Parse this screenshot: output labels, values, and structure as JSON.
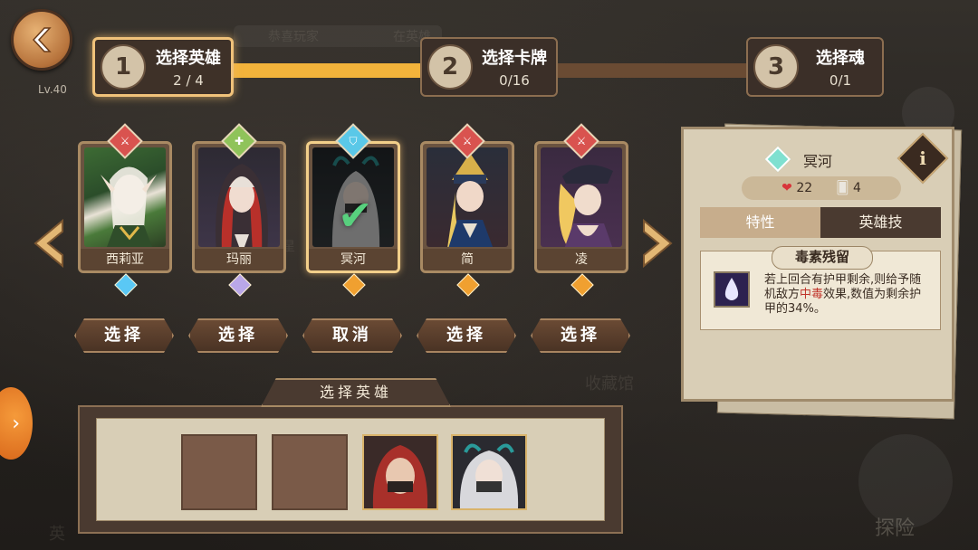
{
  "player": {
    "level": "Lv.40"
  },
  "steps": [
    {
      "number": "1",
      "title": "选择英雄",
      "count": "2 / 4",
      "active": true
    },
    {
      "number": "2",
      "title": "选择卡牌",
      "count": "0/16",
      "active": false
    },
    {
      "number": "3",
      "title": "选择魂",
      "count": "0/1",
      "active": false
    }
  ],
  "progress": {
    "fraction": 0.45
  },
  "heroes": [
    {
      "name": "西莉亚",
      "action": "选择",
      "class_color": "#d9534f",
      "rarity_color": "#5ac8f5",
      "selected": false
    },
    {
      "name": "玛丽",
      "action": "选择",
      "class_color": "#8fc35a",
      "rarity_color": "#b9a7e8",
      "selected": false
    },
    {
      "name": "冥河",
      "action": "取消",
      "class_color": "#5ac8e8",
      "rarity_color": "#f0a030",
      "selected": true
    },
    {
      "name": "简",
      "action": "选择",
      "class_color": "#d9534f",
      "rarity_color": "#f0a030",
      "selected": false
    },
    {
      "name": "凌",
      "action": "选择",
      "class_color": "#d9534f",
      "rarity_color": "#f0a030",
      "selected": false
    }
  ],
  "detail": {
    "hero_name": "冥河",
    "health": "22",
    "cards": "4",
    "tabs": [
      "特性",
      "英雄技"
    ],
    "trait_name": "毒素残留",
    "trait_desc_1": "若上回合有护甲剩余,则给予随机敌方",
    "trait_desc_hl": "中毒",
    "trait_desc_2": "效果,数值为剩余护甲的34%。"
  },
  "selection": {
    "title": "选择英雄",
    "slots": [
      "empty",
      "empty",
      "filled",
      "filled"
    ]
  },
  "background": {
    "labels": [
      "恭喜玩家",
      "在英雄",
      "收藏馆",
      "英",
      "探险",
      "星"
    ]
  }
}
